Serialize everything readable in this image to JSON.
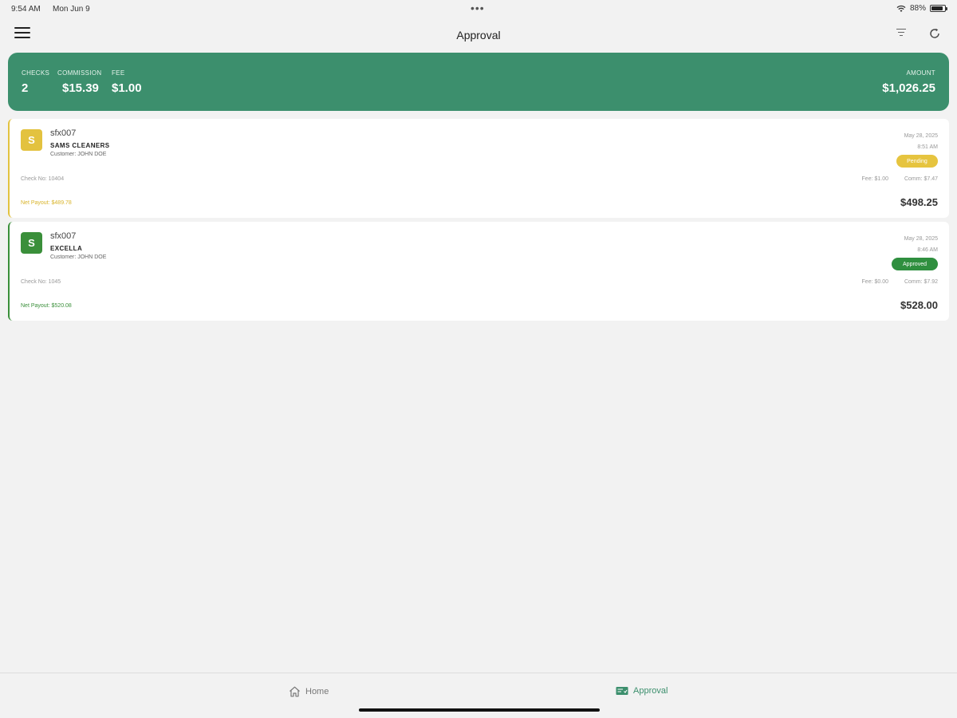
{
  "status_bar": {
    "time": "9:54 AM",
    "date": "Mon Jun 9",
    "dots": "•••",
    "battery": "88%"
  },
  "nav": {
    "title": "Approval"
  },
  "summary": {
    "checks_label": "CHECKS",
    "checks_value": "2",
    "commission_label": "COMMISSION",
    "commission_value": "$15.39",
    "fee_label": "FEE",
    "fee_value": "$1.00",
    "amount_label": "AMOUNT",
    "amount_value": "$1,026.25",
    "color": "#3c8f6d"
  },
  "cards": [
    {
      "initial": "S",
      "code": "sfx007",
      "merchant": "SAMS CLEANERS",
      "customer": "Customer: JOHN DOE",
      "date": "May 28, 2025",
      "time": "8:51 AM",
      "status": "Pending",
      "check_no": "Check No: 10404",
      "fee": "Fee: $1.00",
      "comm": "Comm: $7.47",
      "net_payout": "Net Payout: $489.78",
      "amount": "$498.25",
      "accent": "#e3c23f"
    },
    {
      "initial": "S",
      "code": "sfx007",
      "merchant": "EXCELLA",
      "customer": "Customer: JOHN DOE",
      "date": "May 28, 2025",
      "time": "8:46 AM",
      "status": "Approved",
      "check_no": "Check No: 1045",
      "fee": "Fee: $0.00",
      "comm": "Comm: $7.92",
      "net_payout": "Net Payout: $520.08",
      "amount": "$528.00",
      "accent": "#3a8f3a"
    }
  ],
  "tabs": {
    "home_label": "Home",
    "approval_label": "Approval"
  }
}
